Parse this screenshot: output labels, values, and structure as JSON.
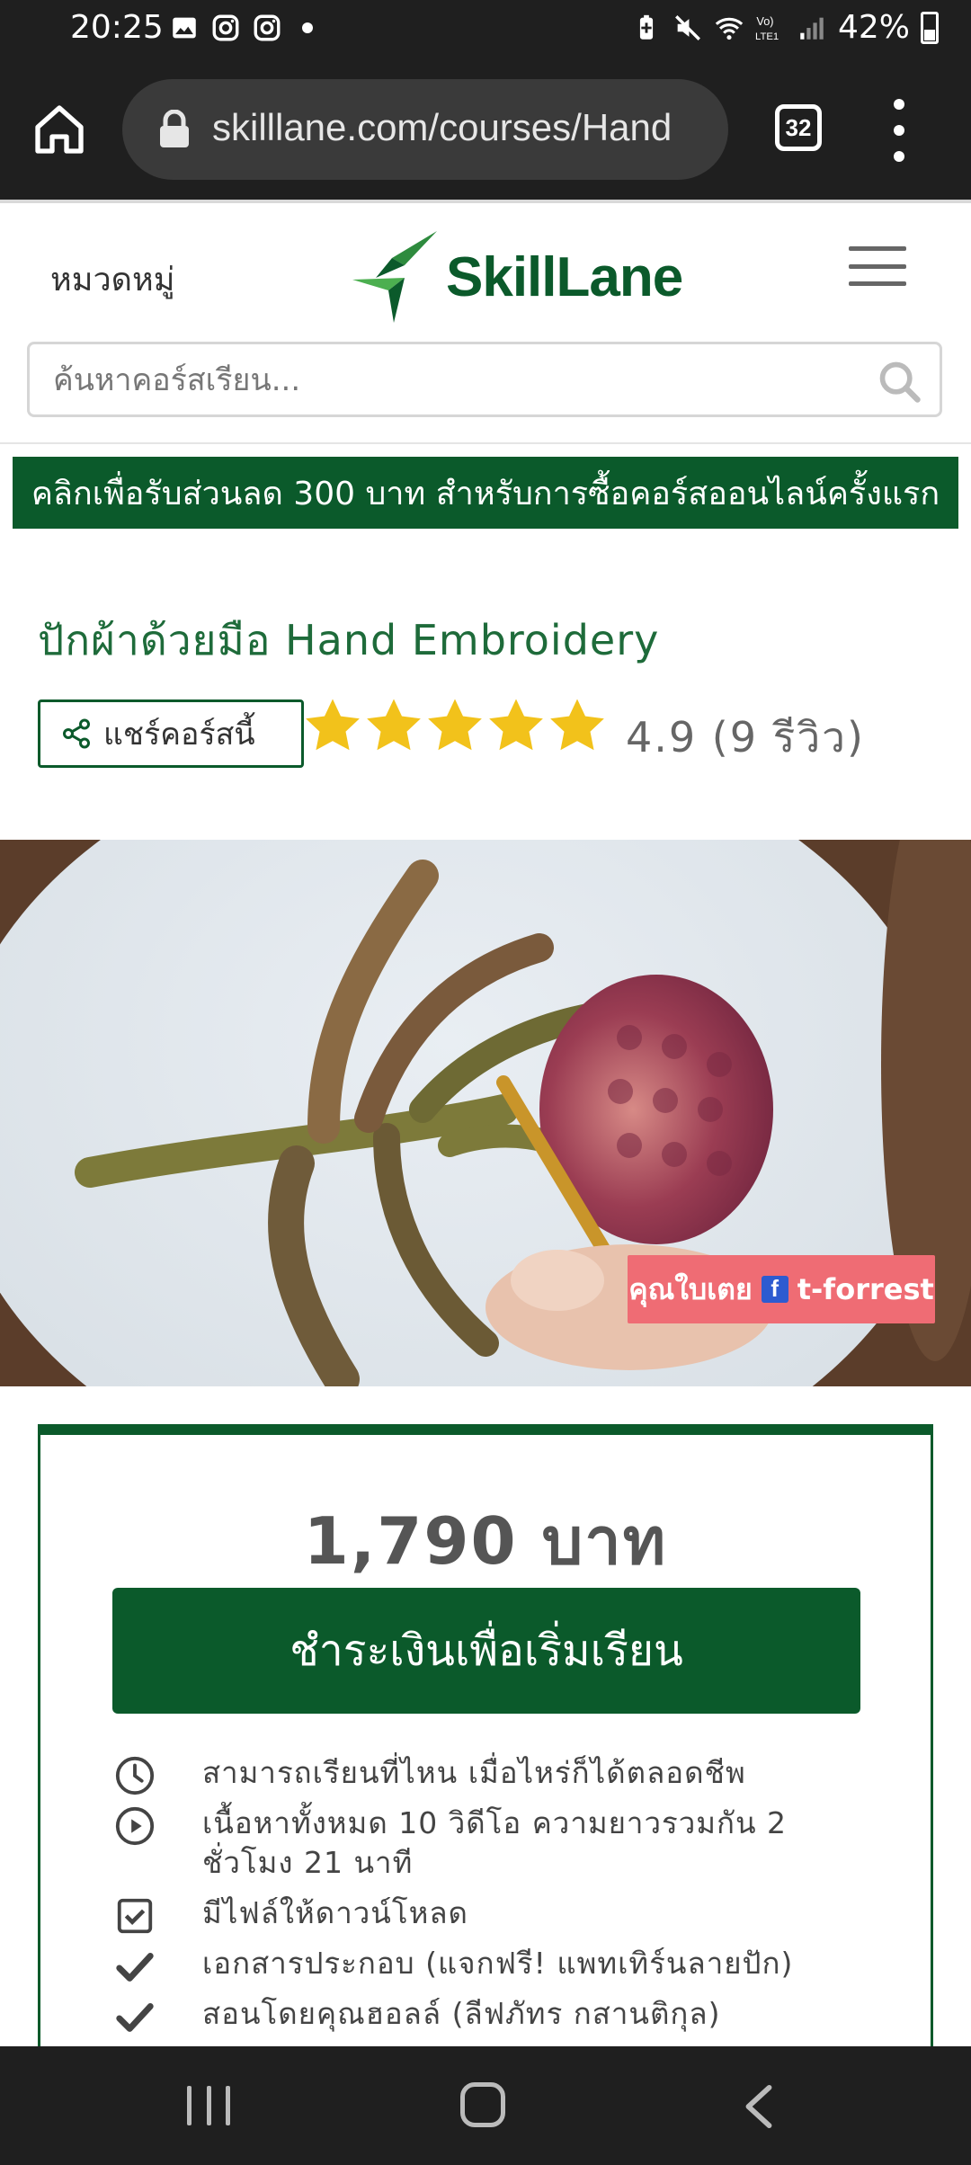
{
  "status_bar": {
    "time": "20:25",
    "battery": "42%",
    "icons": [
      "image-icon",
      "instagram-icon",
      "instagram-icon",
      "dot-icon",
      "battery-saver-icon",
      "mute-icon",
      "wifi-icon",
      "volte-icon",
      "signal-icon",
      "battery-icon"
    ]
  },
  "browser": {
    "url": "skilllane.com/courses/Hand",
    "tab_count": "32"
  },
  "header": {
    "category_label": "หมวดหมู่",
    "logo_text": "SkillLane",
    "search_placeholder": "ค้นหาคอร์สเรียน..."
  },
  "promo": {
    "text": "คลิกเพื่อรับส่วนลด 300 บาท สำหรับการซื้อคอร์สออนไลน์ครั้งแรก"
  },
  "course": {
    "title": "ปักผ้าด้วยมือ Hand Embroidery",
    "share_label": "แชร์คอร์สนี้",
    "rating_value": 4.9,
    "rating_text": "4.9 (9 รีวิว)"
  },
  "video": {
    "credit_name": "คุณใบเตย",
    "credit_handle": "t-forrest"
  },
  "purchase": {
    "price": "1,790 บาท",
    "enroll_label": "ชำระเงินเพื่อเริ่มเรียน",
    "features": [
      {
        "icon": "clock-icon",
        "text": "สามารถเรียนที่ไหน เมื่อไหร่ก็ได้ตลอดชีพ"
      },
      {
        "icon": "play-circle-icon",
        "text": "เนื้อหาทั้งหมด 10 วิดีโอ ความยาวรวมกัน 2 ชั่วโมง 21 นาที"
      },
      {
        "icon": "checkbox-icon",
        "text": "มีไฟล์ให้ดาวน์โหลด"
      },
      {
        "icon": "checkmark-icon",
        "text": "เอกสารประกอบ (แจกฟรี! แพทเทิร์นลายปัก)"
      },
      {
        "icon": "checkmark-icon",
        "text": "สอนโดยคุณฮอลล์ (ลีฟภัทร กสานติกุล)"
      }
    ]
  },
  "colors": {
    "brand_green": "#0b5a2b",
    "title_green": "#1e6b3a",
    "star_yellow": "#f2c21b",
    "credit_pink": "#ef6c74"
  }
}
